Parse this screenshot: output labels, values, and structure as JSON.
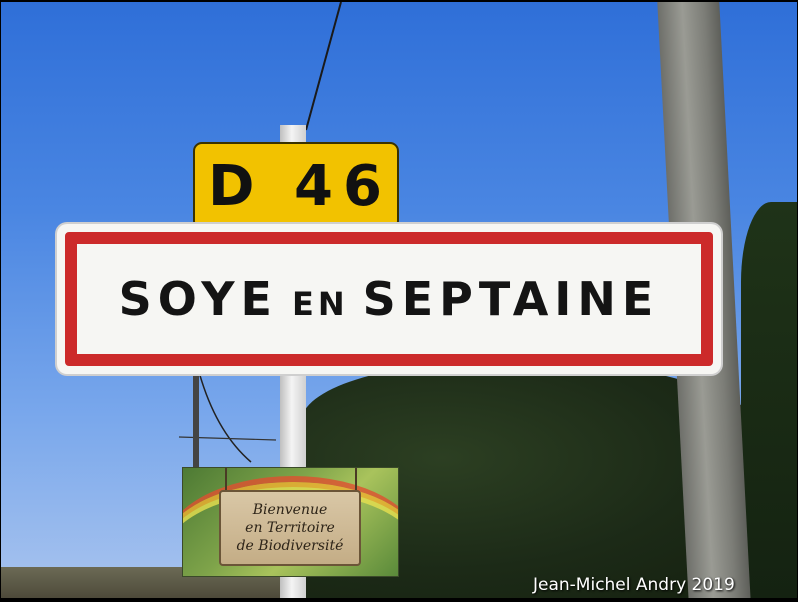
{
  "route_sign": {
    "text": "D 46",
    "color": "#f2c200"
  },
  "town_sign": {
    "word1": "SOYE",
    "word2": "EN",
    "word3": "SEPTAINE",
    "border_color": "#cc2a2a"
  },
  "biodiversity_panel": {
    "line1": "Bienvenue",
    "line2": "en Territoire",
    "line3": "de Biodiversité"
  },
  "credit": "Jean-Michel Andry 2019"
}
